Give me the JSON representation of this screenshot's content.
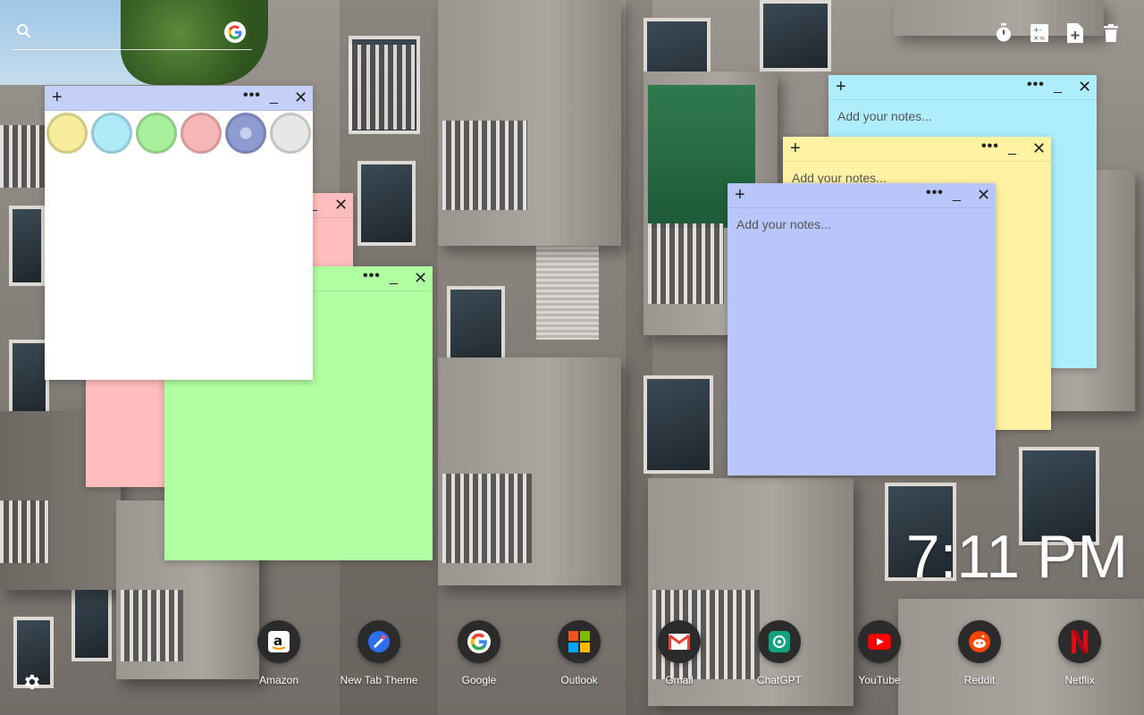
{
  "search": {
    "placeholder": "",
    "icon": "search-icon",
    "engine_icon": "google-icon"
  },
  "toolbar": {
    "icons": [
      "timer-icon",
      "calculator-icon",
      "add-document-icon",
      "trash-icon"
    ]
  },
  "notes": {
    "placeholder": "Add your notes...",
    "colors_palette": [
      "#f6ec9c",
      "#aeeaf8",
      "#a8ef9c",
      "#f7b6b6",
      "#7f8fc8",
      "#e7e7e7"
    ],
    "note_colors": {
      "pink": "#ffbdbd",
      "green": "#b0ffa0",
      "white": "#ffffff",
      "white_bar": "#c4d0f7",
      "cyan": "#aeeefc",
      "yellow": "#fff2a3",
      "blue": "#b9c6fb"
    },
    "controls": {
      "add": "+",
      "more": "•••",
      "minimize": "_",
      "close": "✕"
    }
  },
  "clock": {
    "time": "7:11 PM"
  },
  "shortcuts": [
    {
      "label": "Amazon",
      "icon": "amazon-icon"
    },
    {
      "label": "New Tab Theme",
      "icon": "new-tab-theme-icon"
    },
    {
      "label": "Google",
      "icon": "google-icon"
    },
    {
      "label": "Outlook",
      "icon": "outlook-icon"
    },
    {
      "label": "Gmail",
      "icon": "gmail-icon"
    },
    {
      "label": "ChatGPT",
      "icon": "chatgpt-icon"
    },
    {
      "label": "YouTube",
      "icon": "youtube-icon"
    },
    {
      "label": "Reddit",
      "icon": "reddit-icon"
    },
    {
      "label": "Netflix",
      "icon": "netflix-icon"
    }
  ],
  "settings": {
    "icon": "gear-icon"
  }
}
